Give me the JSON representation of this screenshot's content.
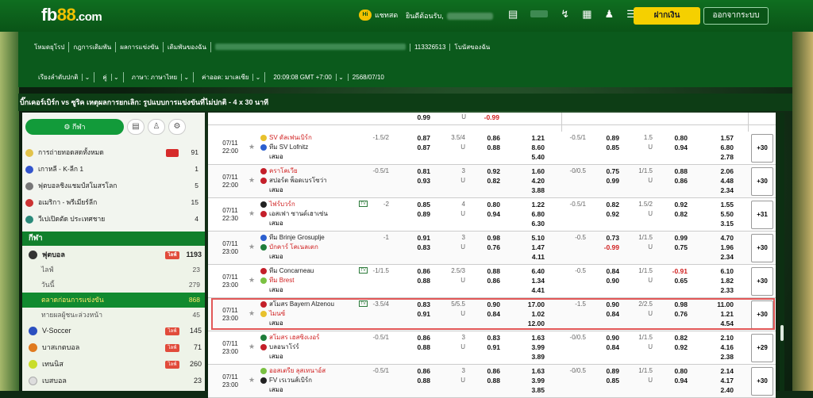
{
  "header": {
    "brand": {
      "main": "fb",
      "num": "88",
      "suffix": ".com"
    },
    "chat_label": "แชทสด",
    "welcome": "ยินดีต้อนรับ,",
    "deposit_label": "ฝากเงิน",
    "logout_label": "ออกจากระบบ"
  },
  "nav": {
    "items": [
      "โหมดยุโรป",
      "กฎการเดิมพัน",
      "ผลการแข่งขัน",
      "เดิมพันของฉัน"
    ],
    "account_id": "113326513",
    "promo": "โบนัสของฉัน"
  },
  "settings": {
    "sort": "เรียงลำดับปกติ",
    "pair": "คู่",
    "language": "ภาษา: ภาษาไทย",
    "odds": "ค่าออด: มาเลเซีย",
    "clock": "20:09:08 GMT +7:00",
    "date": "2568/07/10"
  },
  "ticker": "บิ๊กเคอร์เบิร์ก vs ซูริค เหตุผลการยกเลิก: รูปแบบการแข่งขันที่ไม่ปกติ - 4 x 30 นาที",
  "sidebar": {
    "fav_label": "กีฬา",
    "quick": [
      {
        "label": "การถ่ายทอดสดทั้งหมด",
        "count": "91",
        "badge": true
      },
      {
        "label": "เกาหลี - K-ลีก 1",
        "count": "1"
      },
      {
        "label": "ฟุตบอลชิงแชมป์สโมสรโลก",
        "count": "5"
      },
      {
        "label": "อเมริกา - พรีเมียร์ลีก",
        "count": "15"
      },
      {
        "label": "วีเปเปิดตัด ประเทศชาย",
        "count": "4"
      }
    ],
    "sport_header": "กีฬา",
    "soccer": {
      "label": "ฟุตบอล",
      "live": "ไลฟ์",
      "count": "1193"
    },
    "soccer_subs": [
      {
        "label": "ไลฟ์",
        "count": "23"
      },
      {
        "label": "วันนี้",
        "count": "279"
      },
      {
        "label": "ตลาดก่อนการแข่งขัน",
        "count": "868"
      },
      {
        "label": "ทายผลผู้ชนะล่วงหน้า",
        "count": "45"
      }
    ],
    "others": [
      {
        "label": "V-Soccer",
        "live": "ไลฟ์",
        "count": "145",
        "color": "#2b4fc0"
      },
      {
        "label": "บาสเกตบอล",
        "live": "ไลฟ์",
        "count": "71",
        "color": "#e07a1f"
      },
      {
        "label": "เทนนิส",
        "live": "ไลฟ์",
        "count": "260",
        "color": "#c9dd2a"
      },
      {
        "label": "เบสบอล",
        "live": "",
        "count": "23",
        "color": "#ddd"
      }
    ]
  },
  "more_labels": [
    "+30",
    "+30",
    "+31",
    "+30",
    "+30",
    "+30",
    "+29",
    "+30"
  ],
  "matches": [
    {
      "date": "07/11",
      "time": "22:00",
      "home": "SV ดัลเฟนเบิร์ก",
      "away": "ทีม SV Lofnitz",
      "draw": "เสมอ"
    },
    {
      "date": "07/11",
      "time": "22:00",
      "home": "คราโคเวีย",
      "away": "สปอร์ต พ็อดเบรโซว่า",
      "draw": "เสมอ"
    },
    {
      "date": "07/11",
      "time": "22:30",
      "home": "ไฟร์บวร์ก",
      "away": "เอสเฟา ซานด์เฮาเซ่น",
      "draw": "เสมอ"
    },
    {
      "date": "07/11",
      "time": "23:00",
      "home": "ทีม Brinje Grosuplje",
      "away": "บักคาร์ โคเนลเตก",
      "draw": "เสมอ"
    },
    {
      "date": "07/11",
      "time": "23:00",
      "home": "ทีม Concarneau",
      "away": "ทีม Brest",
      "draw": "เสมอ"
    },
    {
      "date": "07/11",
      "time": "23:00",
      "home": "สโมสร Bayern Alzenou",
      "away": "ไมนซ์",
      "draw": "เสมอ"
    },
    {
      "date": "07/11",
      "time": "23:00",
      "home": "สโมสร เฮสซิงเงอร์",
      "away": "บลอนาโร่ร์",
      "draw": "เสมอ"
    },
    {
      "date": "07/11",
      "time": "23:00",
      "home": "ออสเตรีย ลุสเทนาอ์ส",
      "away": "FV เรเวนส์เบิร์ก",
      "draw": "เสมอ"
    }
  ],
  "top_partial": {
    "a": "0.99",
    "u": "U",
    "b": "-0.99"
  },
  "odds": [
    {
      "hcp": "-1.5/2",
      "h1": "0.87",
      "h2": "0.87",
      "ou": "3.5/4",
      "ou_u": "U",
      "o1": "0.86",
      "o2": "0.88",
      "x1": "1.21",
      "x2": "8.60",
      "x3": "5.40",
      "fh": "-0.5/1",
      "f1": "0.89",
      "f2": "0.85",
      "fou": "1.5",
      "fou_u": "U",
      "g1": "0.80",
      "g2": "0.94",
      "y1": "1.57",
      "y2": "6.80",
      "y3": "2.78"
    },
    {
      "hcp": "-0.5/1",
      "h1": "0.81",
      "h2": "0.93",
      "ou": "3",
      "ou_u": "U",
      "o1": "0.92",
      "o2": "0.82",
      "x1": "1.60",
      "x2": "4.20",
      "x3": "3.88",
      "fh": "-0/0.5",
      "f1": "0.75",
      "f2": "0.99",
      "fou": "1/1.5",
      "fou_u": "U",
      "g1": "0.88",
      "g2": "0.86",
      "y1": "2.06",
      "y2": "4.48",
      "y3": "2.34"
    },
    {
      "hcp": "-2",
      "h1": "0.85",
      "h2": "0.89",
      "ou": "4",
      "ou_u": "U",
      "o1": "0.80",
      "o2": "0.94",
      "x1": "1.22",
      "x2": "6.80",
      "x3": "6.30",
      "fh": "-0.5/1",
      "f1": "0.82",
      "f2": "0.92",
      "fou": "1.5/2",
      "fou_u": "U",
      "g1": "0.92",
      "g2": "0.82",
      "y1": "1.55",
      "y2": "5.50",
      "y3": "3.15"
    },
    {
      "hcp": "-1",
      "h1": "0.91",
      "h2": "0.83",
      "ou": "3",
      "ou_u": "U",
      "o1": "0.98",
      "o2": "0.76",
      "x1": "5.10",
      "x2": "1.47",
      "x3": "4.11",
      "fh": "-0.5",
      "f1": "0.73",
      "f2": "-0.99",
      "fou": "1/1.5",
      "fou_u": "U",
      "g1": "0.99",
      "g2": "0.75",
      "y1": "4.70",
      "y2": "1.96",
      "y3": "2.34"
    },
    {
      "hcp": "-1/1.5",
      "h1": "0.86",
      "h2": "0.88",
      "ou": "2.5/3",
      "ou_u": "U",
      "o1": "0.88",
      "o2": "0.86",
      "x1": "6.40",
      "x2": "1.34",
      "x3": "4.41",
      "fh": "-0.5",
      "f1": "0.84",
      "f2": "0.90",
      "fou": "1/1.5",
      "fou_u": "U",
      "g1": "-0.91",
      "g2": "0.65",
      "y1": "6.10",
      "y2": "1.82",
      "y3": "2.33"
    },
    {
      "hcp": "-3.5/4",
      "h1": "0.83",
      "h2": "0.91",
      "ou": "5/5.5",
      "ou_u": "U",
      "o1": "0.90",
      "o2": "0.84",
      "x1": "17.00",
      "x2": "1.02",
      "x3": "12.00",
      "fh": "-1.5",
      "f1": "0.90",
      "f2": "0.84",
      "fou": "2/2.5",
      "fou_u": "U",
      "g1": "0.98",
      "g2": "0.76",
      "y1": "11.00",
      "y2": "1.21",
      "y3": "4.54"
    },
    {
      "hcp": "-0.5/1",
      "h1": "0.86",
      "h2": "0.88",
      "ou": "3",
      "ou_u": "U",
      "o1": "0.83",
      "o2": "0.91",
      "x1": "1.63",
      "x2": "3.99",
      "x3": "3.89",
      "fh": "-0/0.5",
      "f1": "0.90",
      "f2": "0.84",
      "fou": "1/1.5",
      "fou_u": "U",
      "g1": "0.82",
      "g2": "0.92",
      "y1": "2.10",
      "y2": "4.16",
      "y3": "2.38"
    },
    {
      "hcp": "-0.5/1",
      "h1": "0.86",
      "h2": "0.88",
      "ou": "3",
      "ou_u": "U",
      "o1": "0.86",
      "o2": "0.88",
      "x1": "1.63",
      "x2": "3.99",
      "x3": "3.85",
      "fh": "-0/0.5",
      "f1": "0.89",
      "f2": "0.85",
      "fou": "1/1.5",
      "fou_u": "U",
      "g1": "0.80",
      "g2": "0.94",
      "y1": "2.14",
      "y2": "4.17",
      "y3": "2.40"
    }
  ],
  "negatives": [
    "-0.99",
    "-0.91",
    "-0.99"
  ],
  "colors": {
    "brand_green": "#0a5417",
    "accent_yellow": "#f5d000",
    "highlight_red": "#e25858"
  }
}
